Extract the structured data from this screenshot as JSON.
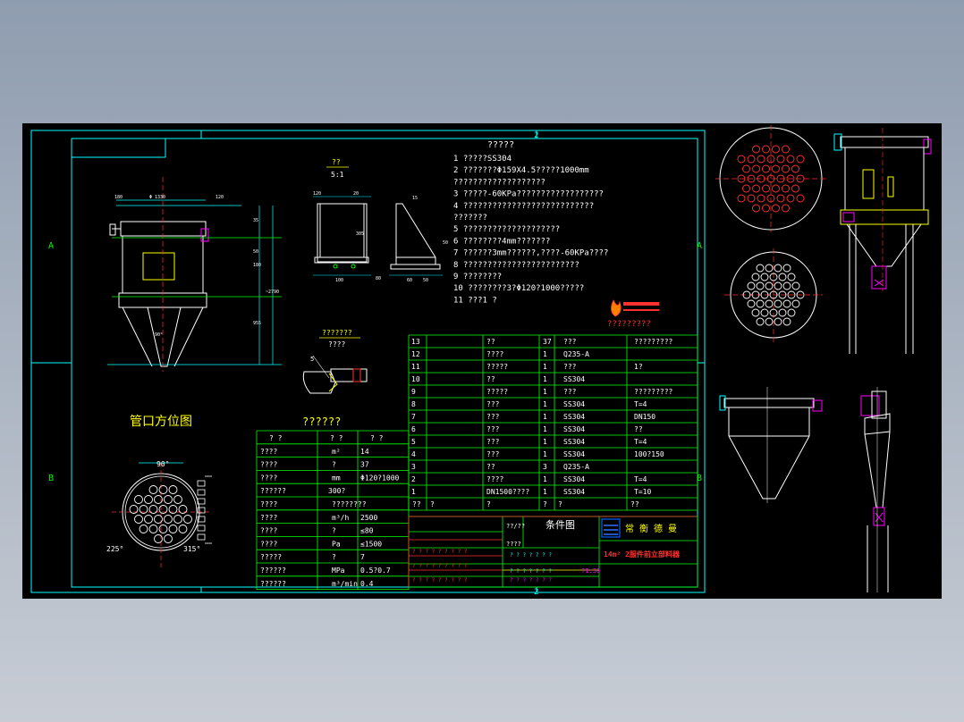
{
  "colors": {
    "background": "#000000",
    "border": "#00ffff",
    "text": "#ffffff",
    "title": "#ffff00",
    "table_line": "#00ff00",
    "accent": "#ff0000",
    "magenta": "#ff00ff"
  },
  "frame": {
    "zone_A_left": "A",
    "zone_A_right": "A",
    "zone_B_left": "B",
    "zone_B_right": "B",
    "top_marker": "2",
    "bottom_marker": "2"
  },
  "notes": {
    "title": "?????",
    "lines": [
      "1  ?????SS304",
      "2  ???????Φ159X4.5?????1000mm",
      "    ???????????????????",
      "3  ?????-60KPa??????????????????",
      "4  ???????????????????????????",
      "    ???????",
      "5  ????????????????????",
      "6  ????????4mm???????",
      "7  ??????3mm??????,????-60KPa????",
      "8  ????????????????????????",
      "9  ????????",
      "10  ????????3?Φ120?1000?????",
      "11  ???1  ?"
    ]
  },
  "detail": {
    "scale_num": "??",
    "scale": "5:1",
    "weld_label": "???????",
    "weld_sub": "????",
    "weld_size": "5"
  },
  "logo_caption": "?????????",
  "nozzle_view": {
    "title": "管口方位图",
    "angle_90": "90°",
    "angle_225": "225°",
    "angle_315": "315°"
  },
  "tech_table": {
    "title": "??????",
    "header": [
      "?   ?",
      "?   ?",
      "?   ?"
    ],
    "rows": [
      [
        "????",
        "m²",
        "14"
      ],
      [
        "????",
        "?",
        "37"
      ],
      [
        "????",
        "mm",
        "Φ120?1000"
      ],
      [
        "??????",
        "300?",
        ""
      ],
      [
        "????",
        "????????",
        ""
      ],
      [
        "????",
        "m³/h",
        "2500"
      ],
      [
        "????",
        "?",
        "≤80"
      ],
      [
        "????",
        "Pa",
        "≤1500"
      ],
      [
        "?????",
        "?",
        "7"
      ],
      [
        "??????",
        "MPa",
        "0.5?0.7"
      ],
      [
        "??????",
        "m³/min",
        "0.4"
      ]
    ]
  },
  "parts_table": {
    "rows": [
      [
        "13",
        "",
        "??",
        "37",
        "???",
        "?????????"
      ],
      [
        "12",
        "",
        "????",
        "1",
        "Q235-A",
        ""
      ],
      [
        "11",
        "",
        "?????",
        "1",
        "???",
        "1?"
      ],
      [
        "10",
        "",
        "??",
        "1",
        "SS304",
        ""
      ],
      [
        "9",
        "",
        "?????",
        "1",
        "???",
        "?????????"
      ],
      [
        "8",
        "",
        "???",
        "1",
        "SS304",
        "T=4"
      ],
      [
        "7",
        "",
        "???",
        "1",
        "SS304",
        "DN150"
      ],
      [
        "6",
        "",
        "???",
        "1",
        "SS304",
        "??"
      ],
      [
        "5",
        "",
        "???",
        "1",
        "SS304",
        "T=4"
      ],
      [
        "4",
        "",
        "???",
        "1",
        "SS304",
        "100?150"
      ],
      [
        "3",
        "",
        "??",
        "3",
        "Q235-A",
        ""
      ],
      [
        "2",
        "",
        "????",
        "1",
        "SS304",
        "T=4"
      ],
      [
        "1",
        "",
        "DN1500????",
        "1",
        "SS304",
        "T=10"
      ]
    ],
    "header": [
      "??",
      "?",
      "?",
      "?",
      "?",
      "??"
    ]
  },
  "title_block": {
    "drawing_type": "条件图",
    "company": "常 衡 德 曼",
    "product": "14m² 2服件前立部料器",
    "label_a": "??/??",
    "label_b": "????",
    "scale_mark": "?1:30"
  }
}
